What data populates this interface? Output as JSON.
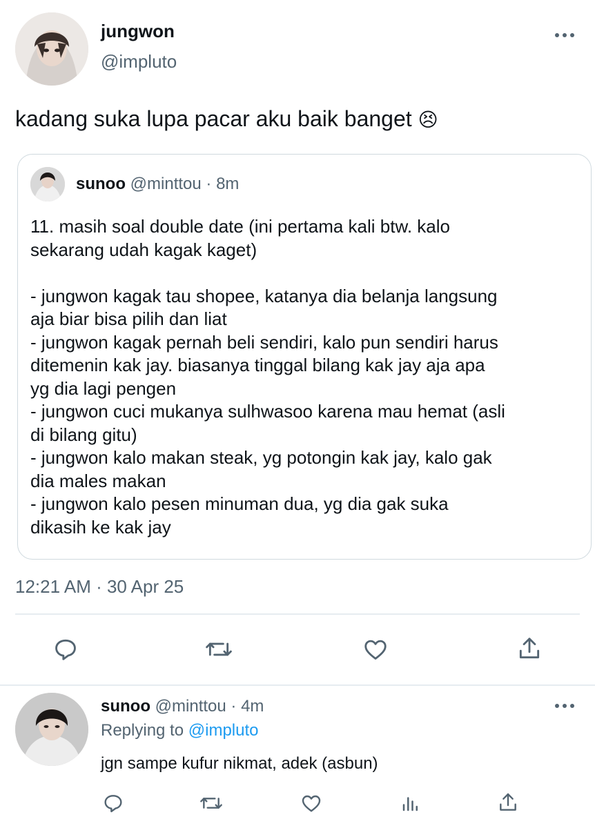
{
  "main_tweet": {
    "author_name": "jungwon",
    "author_handle": "@impluto",
    "text": "kadang suka lupa pacar aku baik banget",
    "emoji": "😣",
    "timestamp": "12:21 AM · 30 Apr 25"
  },
  "quoted_tweet": {
    "author_name": "sunoo",
    "author_handle": "@minttou",
    "time_ago": "· 8m",
    "lines": [
      "11. masih soal double date (ini pertama kali btw. kalo",
      "sekarang udah kagak kaget)",
      "",
      "- jungwon kagak tau shopee, katanya dia belanja langsung",
      "aja biar bisa pilih dan liat",
      "- jungwon kagak pernah beli sendiri, kalo pun sendiri harus",
      "ditemenin kak jay. biasanya tinggal bilang kak jay aja apa",
      "yg dia lagi pengen",
      "- jungwon cuci mukanya sulhwasoo karena mau hemat (asli",
      "di bilang gitu)",
      "- jungwon kalo makan steak, yg potongin kak jay, kalo gak",
      "dia males makan",
      "- jungwon kalo pesen minuman dua, yg dia gak suka",
      "dikasih ke kak jay"
    ]
  },
  "reply": {
    "author_name": "sunoo",
    "author_handle": "@minttou",
    "time_ago": "· 4m",
    "replying_prefix": "Replying to",
    "replying_to": "@impluto",
    "text": "jgn sampe kufur nikmat, adek (asbun)"
  },
  "icons": {
    "reply": "reply-icon",
    "retweet": "retweet-icon",
    "like": "like-icon",
    "share": "share-icon",
    "views": "views-icon",
    "more": "more-icon"
  },
  "colors": {
    "text": "#0f1419",
    "muted": "#536471",
    "link": "#1d9bf0",
    "border": "#cfd9de"
  }
}
